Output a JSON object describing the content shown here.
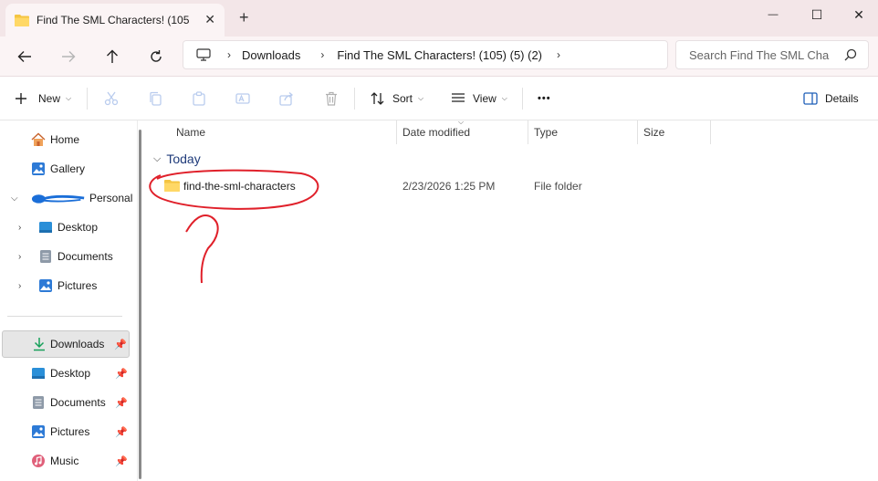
{
  "window": {
    "tab_title": "Find The SML Characters! (105",
    "tab_close": "✕",
    "new_tab": "+",
    "minimize": "—",
    "maximize": "☐",
    "close": "✕"
  },
  "address": {
    "crumbs": [
      "Downloads",
      "Find The SML Characters! (105) (5) (2)"
    ],
    "search_placeholder": "Search Find The SML Cha"
  },
  "toolbar": {
    "new_label": "New",
    "sort_label": "Sort",
    "view_label": "View",
    "more_label": "•••",
    "details_label": "Details"
  },
  "sidebar": {
    "home": "Home",
    "gallery": "Gallery",
    "personal": "Personal",
    "desktop": "Desktop",
    "documents": "Documents",
    "pictures": "Pictures",
    "quick_downloads": "Downloads",
    "quick_desktop": "Desktop",
    "quick_documents": "Documents",
    "quick_pictures": "Pictures",
    "quick_music": "Music"
  },
  "columns": {
    "name": "Name",
    "date_modified": "Date modified",
    "type": "Type",
    "size": "Size"
  },
  "group": {
    "label": "Today"
  },
  "rows": [
    {
      "name": "find-the-sml-characters",
      "date_modified": "2/23/2026 1:25 PM",
      "type": "File folder",
      "size": ""
    }
  ],
  "colors": {
    "titlebar_bg": "#f3e6e8",
    "folder_yellow": "#f4c542",
    "annotation_red": "#e0202a",
    "group_text": "#1f3b7a"
  }
}
